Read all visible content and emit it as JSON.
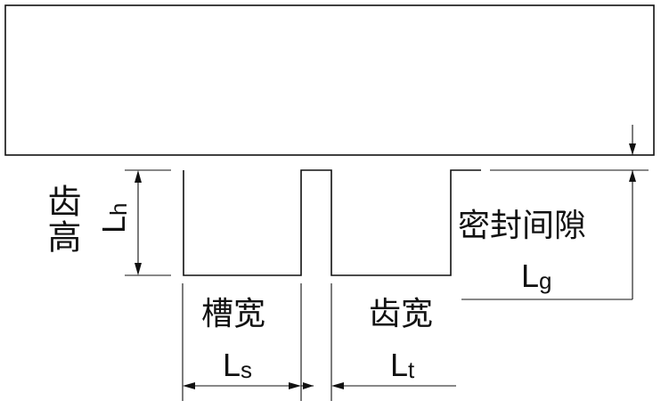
{
  "labels": {
    "tooth_height": "齿高",
    "tooth_height_symbol": "L",
    "tooth_height_sub": "h",
    "slot_width": "槽宽",
    "slot_width_symbol": "L",
    "slot_width_sub": "s",
    "tooth_width": "齿宽",
    "tooth_width_symbol": "L",
    "tooth_width_sub": "t",
    "seal_clearance": "密封间隙",
    "seal_clearance_symbol": "L",
    "seal_clearance_sub": "g"
  }
}
